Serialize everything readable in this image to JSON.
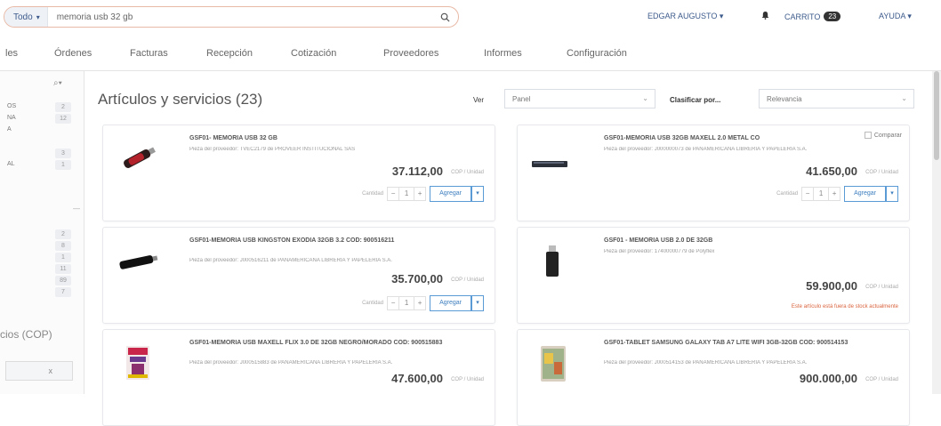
{
  "header": {
    "scope_label": "Todo",
    "search_value": "memoria usb 32 gb",
    "user_label": "EDGAR AUGUSTO",
    "cart_label": "CARRITO",
    "cart_count": "23",
    "help_label": "AYUDA"
  },
  "nav": {
    "items": [
      "les",
      "Órdenes",
      "Facturas",
      "Recepción",
      "Cotización",
      "Proveedores",
      "Informes",
      "Configuración"
    ]
  },
  "sidebar": {
    "filters_top": [
      {
        "label": "OS",
        "count": "2"
      },
      {
        "label": "NA",
        "count": "12"
      },
      {
        "label": "A",
        "count": ""
      },
      {
        "label": "",
        "count": "3"
      },
      {
        "label": "AL",
        "count": "1"
      }
    ],
    "filters_bottom": [
      {
        "count": "2"
      },
      {
        "count": "8"
      },
      {
        "count": "1"
      },
      {
        "count": "11"
      },
      {
        "count": "89"
      },
      {
        "count": "7"
      }
    ],
    "price_title": "cios (COP)",
    "range_value": "x"
  },
  "main": {
    "title": "Artículos y servicios (23)",
    "view_label": "Ver",
    "view_value": "Panel",
    "sort_label": "Clasificar por...",
    "sort_value": "Relevancia",
    "compare_label": "Comparar",
    "qty_label": "Cantidad",
    "add_label": "Agregar",
    "unit_label": "COP / Unidad",
    "out_of_stock": "Este artículo está fuera de stock actualmente"
  },
  "products": [
    {
      "title": "GSF01- MEMORIA USB 32 GB",
      "supplier": "Pieza del proveedor: TVEC2179 de PROVEER INSTITUCIONAL SAS",
      "price": "37.112,00",
      "qty": "1"
    },
    {
      "title": "GSF01-MEMORIA USB 32GB MAXELL 2.0 METAL co",
      "supplier": "Pieza del proveedor: J000000073 de PANAMERICANA LIBRERÍA Y PAPELERÍA S.A.",
      "price": "41.650,00",
      "qty": "1"
    },
    {
      "title": "GSF01-MEMORIA USB KINGSTON EXODIA 32GB 3.2 cod: 900516211",
      "supplier": "Pieza del proveedor: J000516211 de PANAMERICANA LIBRERÍA Y PAPELERÍA S.A.",
      "price": "35.700,00",
      "qty": "1"
    },
    {
      "title": "GSF01 - MEMORIA USB 2.0 DE 32GB",
      "supplier": "Pieza del proveedor: 17400000779 de Polyflex",
      "price": "59.900,00",
      "qty": ""
    },
    {
      "title": "GSF01-MEMORIA USB MAXELL FLIX 3.0 DE 32GB NEGRO/MORADO cod: 900515883",
      "supplier": "Pieza del proveedor: J000515883 de PANAMERICANA LIBRERÍA Y PAPELERÍA S.A.",
      "price": "47.600,00",
      "qty": ""
    },
    {
      "title": "GSF01-TABLET SAMSUNG GALAXY TAB A7 LITE WIFI 3GB-32GB cod: 900514153",
      "supplier": "Pieza del proveedor: J000514153 de PANAMERICANA LIBRERÍA Y PAPELERÍA S.A.",
      "price": "900.000,00",
      "qty": ""
    }
  ]
}
